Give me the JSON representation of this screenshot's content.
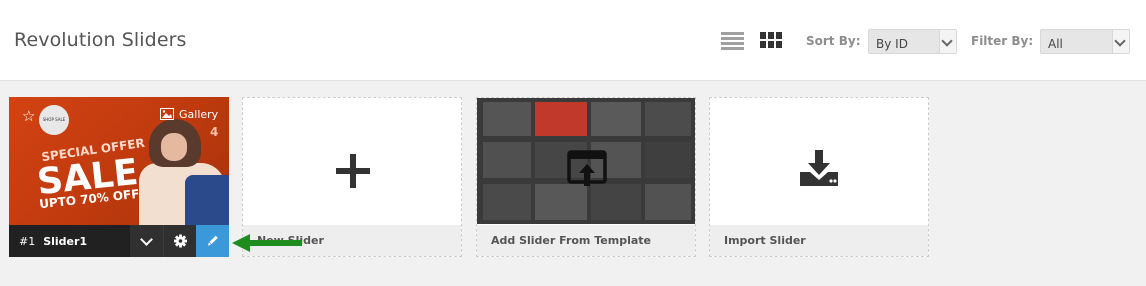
{
  "header": {
    "title": "Revolution Sliders",
    "sort_label": "Sort By:",
    "sort_value": "By ID",
    "filter_label": "Filter By:",
    "filter_value": "All",
    "view_icons": [
      "list-view-icon",
      "grid-view-icon"
    ]
  },
  "slider": {
    "thumb_badge": "SHOP SALE",
    "thumb_special": "SPECIAL OFFER",
    "thumb_sale": "SALE",
    "thumb_upto": "UPTO 70% OFF",
    "gallery_label": "Gallery",
    "slide_count": "4",
    "id_label": "#1",
    "name": "Slider1",
    "actions": [
      "chevron-down-icon",
      "gear-icon",
      "pencil-icon"
    ]
  },
  "cards": {
    "new": "New Slider",
    "template": "Add Slider From Template",
    "import": "Import Slider"
  },
  "colors": {
    "accent_blue": "#3b99d9",
    "annotation_arrow": "#1e8c1e",
    "dark_bar": "#212121"
  }
}
